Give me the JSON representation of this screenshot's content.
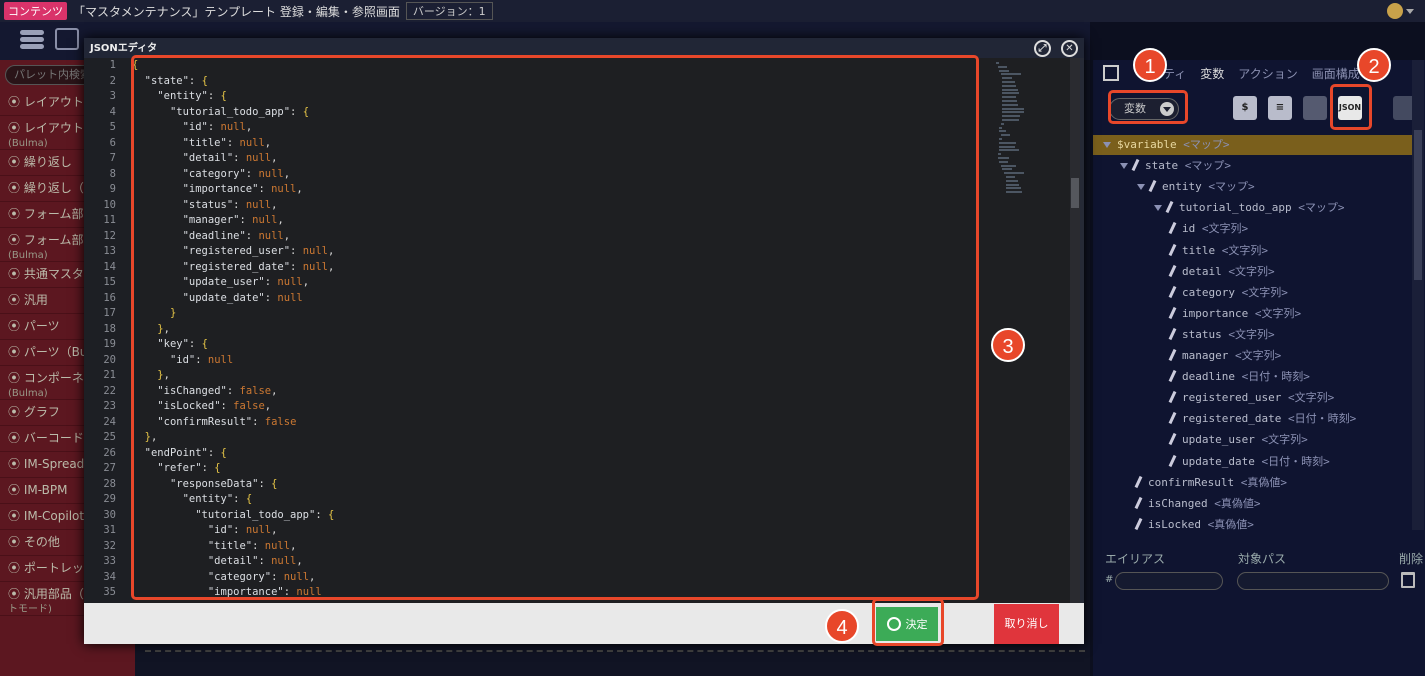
{
  "topbar": {
    "badge": "コンテンツ",
    "title": "「マスタメンテナンス」テンプレート 登録・編集・参照画面",
    "version": "バージョン：1"
  },
  "sidebar": {
    "search_placeholder": "パレット内検索",
    "items": [
      {
        "label": "⦿ レイアウト",
        "sub": ""
      },
      {
        "label": "⦿ レイアウト",
        "sub": "(Bulma)"
      },
      {
        "label": "⦿ 繰り返し",
        "sub": ""
      },
      {
        "label": "⦿ 繰り返し（B",
        "sub": ""
      },
      {
        "label": "⦿ フォーム部品",
        "sub": ""
      },
      {
        "label": "⦿ フォーム部品",
        "sub": "(Bulma)"
      },
      {
        "label": "⦿ 共通マスタ",
        "sub": ""
      },
      {
        "label": "⦿ 汎用",
        "sub": ""
      },
      {
        "label": "⦿ パーツ",
        "sub": ""
      },
      {
        "label": "⦿ パーツ（Bulm",
        "sub": ""
      },
      {
        "label": "⦿ コンポーネン",
        "sub": "(Bulma)"
      },
      {
        "label": "⦿ グラフ",
        "sub": ""
      },
      {
        "label": "⦿ バーコード",
        "sub": ""
      },
      {
        "label": "⦿ IM-Spreads",
        "sub": ""
      },
      {
        "label": "⦿ IM-BPM",
        "sub": ""
      },
      {
        "label": "⦿ IM-Copilot",
        "sub": ""
      },
      {
        "label": "⦿ その他",
        "sub": ""
      },
      {
        "label": "⦿ ポートレット",
        "sub": ""
      },
      {
        "label": "⦿ 汎用部品（L",
        "sub": "トモード)"
      }
    ]
  },
  "right": {
    "tabs": [
      "ティ",
      "変数",
      "アクション",
      "画面構成"
    ],
    "dropdown": "変数",
    "json_button": "JSON",
    "tree": [
      {
        "name": "$variable",
        "type": "<マップ>",
        "indent": 0,
        "kind": "tri",
        "sel": true
      },
      {
        "name": "state",
        "type": "<マップ>",
        "indent": 1,
        "kind": "tri"
      },
      {
        "name": "entity",
        "type": "<マップ>",
        "indent": 2,
        "kind": "tri"
      },
      {
        "name": "tutorial_todo_app",
        "type": "<マップ>",
        "indent": 3,
        "kind": "tri"
      },
      {
        "name": "id",
        "type": "<文字列>",
        "indent": 4,
        "kind": "pen"
      },
      {
        "name": "title",
        "type": "<文字列>",
        "indent": 4,
        "kind": "pen"
      },
      {
        "name": "detail",
        "type": "<文字列>",
        "indent": 4,
        "kind": "pen"
      },
      {
        "name": "category",
        "type": "<文字列>",
        "indent": 4,
        "kind": "pen"
      },
      {
        "name": "importance",
        "type": "<文字列>",
        "indent": 4,
        "kind": "pen"
      },
      {
        "name": "status",
        "type": "<文字列>",
        "indent": 4,
        "kind": "pen"
      },
      {
        "name": "manager",
        "type": "<文字列>",
        "indent": 4,
        "kind": "pen"
      },
      {
        "name": "deadline",
        "type": "<日付・時刻>",
        "indent": 4,
        "kind": "pen"
      },
      {
        "name": "registered_user",
        "type": "<文字列>",
        "indent": 4,
        "kind": "pen"
      },
      {
        "name": "registered_date",
        "type": "<日付・時刻>",
        "indent": 4,
        "kind": "pen"
      },
      {
        "name": "update_user",
        "type": "<文字列>",
        "indent": 4,
        "kind": "pen"
      },
      {
        "name": "update_date",
        "type": "<日付・時刻>",
        "indent": 4,
        "kind": "pen"
      },
      {
        "name": "confirmResult",
        "type": "<真偽値>",
        "indent": 2,
        "kind": "pen"
      },
      {
        "name": "isChanged",
        "type": "<真偽値>",
        "indent": 2,
        "kind": "pen"
      },
      {
        "name": "isLocked",
        "type": "<真偽値>",
        "indent": 2,
        "kind": "pen"
      }
    ],
    "alias_header": "エイリアス",
    "path_header": "対象パス",
    "delete_header": "削除",
    "hash": "#"
  },
  "modal": {
    "title": "JSONエディタ",
    "ok_label": "決定",
    "cancel_label": "取り消し",
    "lines": [
      "{",
      "  \"state\": {",
      "    \"entity\": {",
      "      \"tutorial_todo_app\": {",
      "        \"id\": null,",
      "        \"title\": null,",
      "        \"detail\": null,",
      "        \"category\": null,",
      "        \"importance\": null,",
      "        \"status\": null,",
      "        \"manager\": null,",
      "        \"deadline\": null,",
      "        \"registered_user\": null,",
      "        \"registered_date\": null,",
      "        \"update_user\": null,",
      "        \"update_date\": null",
      "      }",
      "    },",
      "    \"key\": {",
      "      \"id\": null",
      "    },",
      "    \"isChanged\": false,",
      "    \"isLocked\": false,",
      "    \"confirmResult\": false",
      "  },",
      "  \"endPoint\": {",
      "    \"refer\": {",
      "      \"responseData\": {",
      "        \"entity\": {",
      "          \"tutorial_todo_app\": {",
      "            \"id\": null,",
      "            \"title\": null,",
      "            \"detail\": null,",
      "            \"category\": null,",
      "            \"importance\": null"
    ]
  },
  "callouts": [
    "1",
    "2",
    "3",
    "4"
  ],
  "colors": {
    "accent": "#e8472a",
    "ok": "#3cab57",
    "cancel": "#e0353c"
  }
}
